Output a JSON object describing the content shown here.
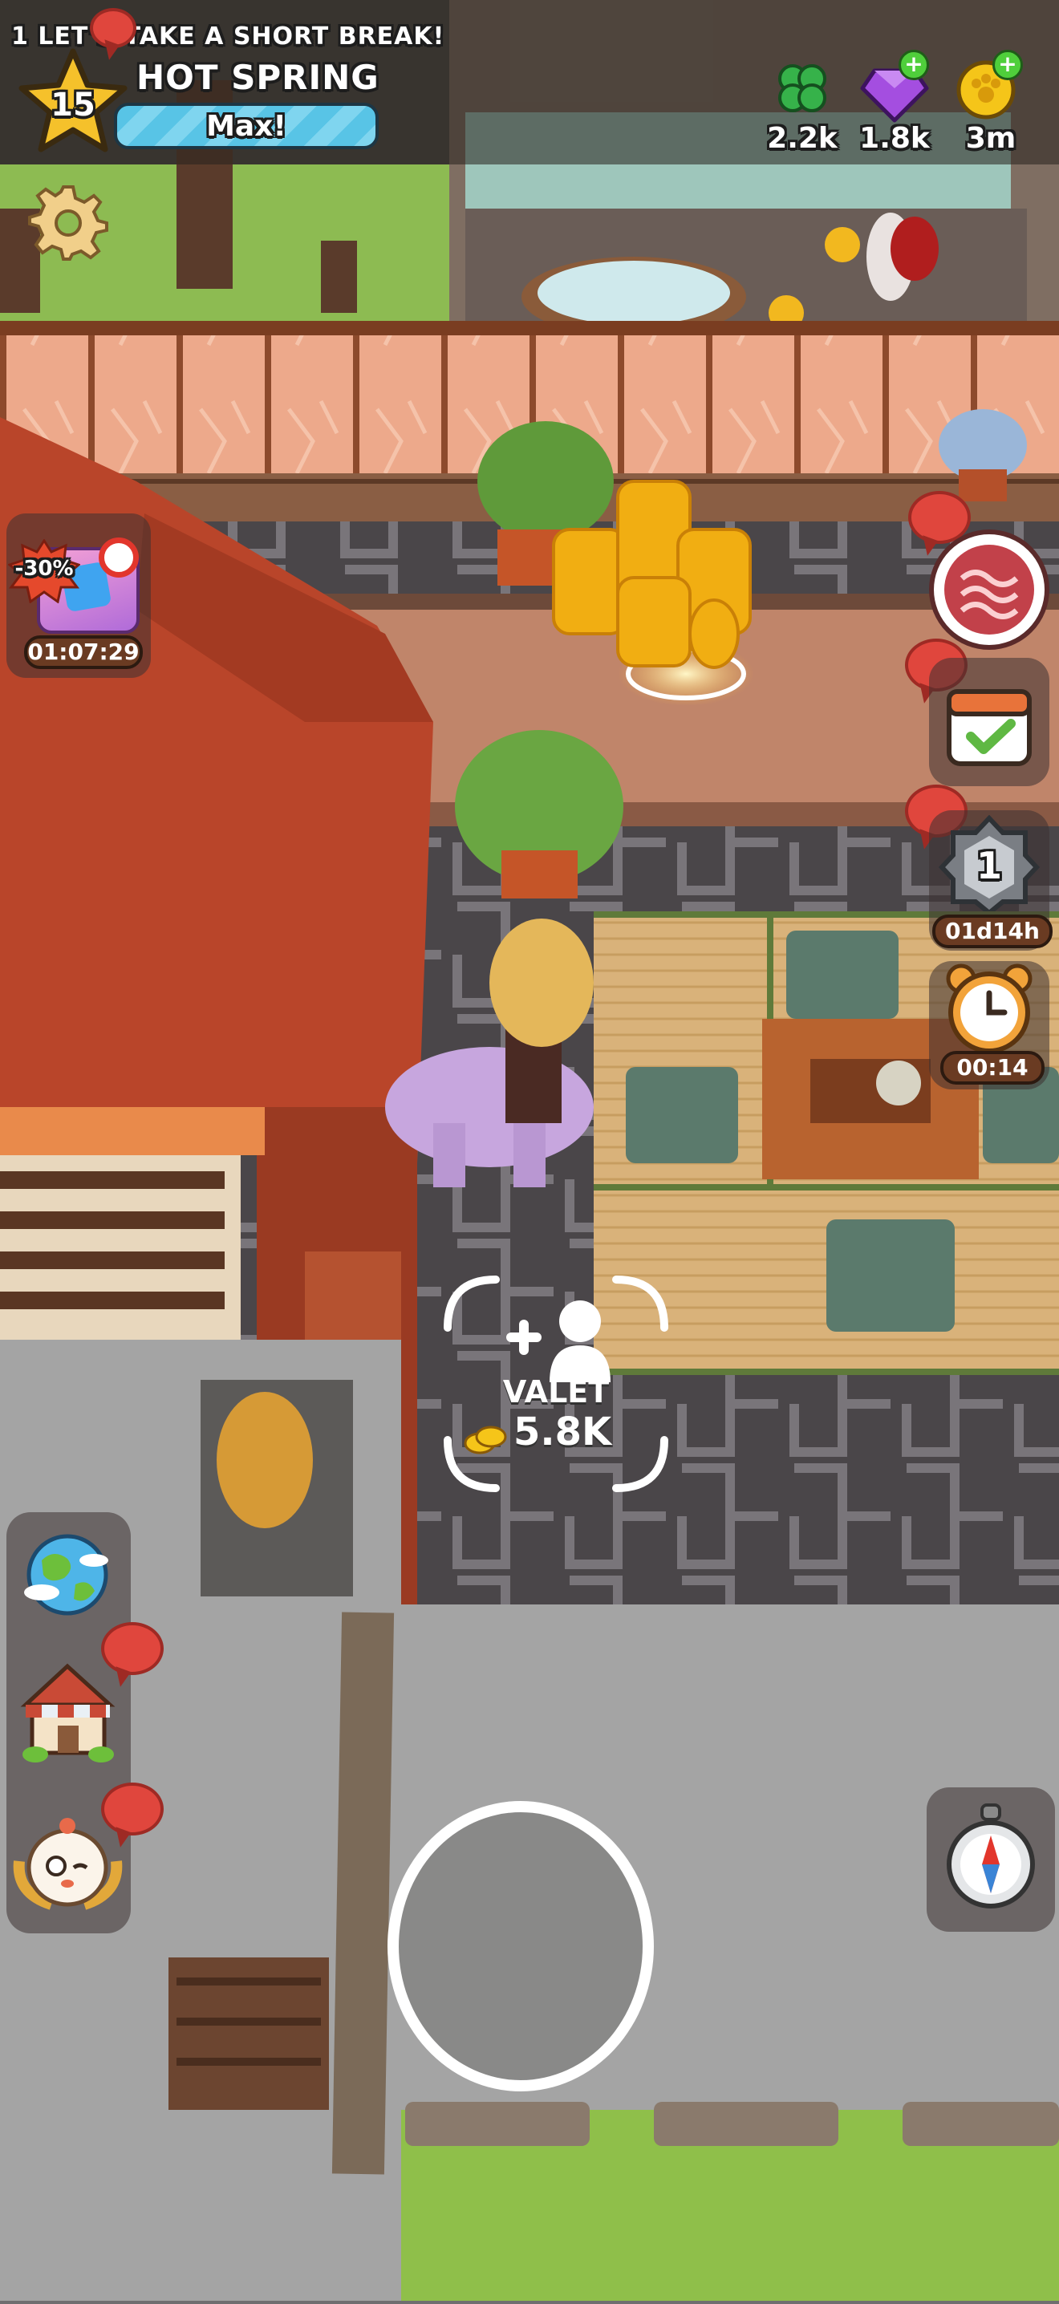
{
  "top_banner": {
    "text": "1 LET'S TAKE A SHORT BREAK!"
  },
  "player": {
    "level": "15",
    "area_name": "HOT SPRING",
    "progress_label": "Max!"
  },
  "currencies": [
    {
      "icon": "clover-icon",
      "value": "2.2k"
    },
    {
      "icon": "gem-icon",
      "value": "1.8k"
    },
    {
      "icon": "paw-coin-icon",
      "value": "3m"
    }
  ],
  "offer": {
    "discount": "-30%",
    "timer": "01:07:29"
  },
  "right_panel": {
    "rank_badge": "1",
    "rank_timer": "01d14h",
    "alarm_timer": "00:14"
  },
  "valet": {
    "label": "VALET",
    "cost": "5.8K"
  },
  "left_menu": [
    "globe-icon",
    "shop-icon",
    "character-icon"
  ],
  "colors": {
    "floor": "#4a4649",
    "wall": "#e8a58a",
    "roof": "#b9452a",
    "grass": "#8fbf4a",
    "accent_blue": "#5ec6e8"
  }
}
